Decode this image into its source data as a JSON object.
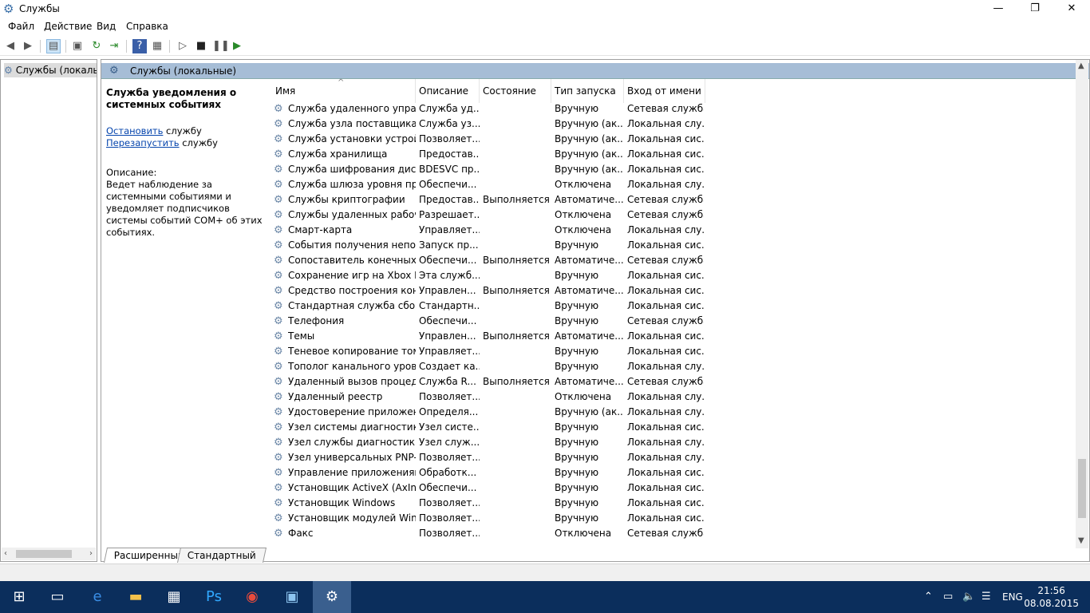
{
  "window": {
    "title": "Службы"
  },
  "menu": [
    "Файл",
    "Действие",
    "Вид",
    "Справка"
  ],
  "tree": {
    "item": "Службы (локалы"
  },
  "header": {
    "title": "Службы (локальные)"
  },
  "details": {
    "service_title": "Служба уведомления о системных событиях",
    "stop_link": "Остановить",
    "stop_suffix": " службу",
    "restart_link": "Перезапустить",
    "restart_suffix": " службу",
    "description_label": "Описание:",
    "description_text": "Ведет наблюдение за системными событиями и уведомляет подписчиков системы событий COM+ об этих событиях."
  },
  "columns": {
    "name": "Имя",
    "description": "Описание",
    "state": "Состояние",
    "startup": "Тип запуска",
    "logon": "Вход от имени"
  },
  "rows": [
    {
      "name": "Служба удаленного управ...",
      "desc": "Служба уд...",
      "state": "",
      "startup": "Вручную",
      "logon": "Сетевая служба"
    },
    {
      "name": "Служба узла поставщика ...",
      "desc": "Служба уз...",
      "state": "",
      "startup": "Вручную (ак...",
      "logon": "Локальная слу..."
    },
    {
      "name": "Служба установки устрой...",
      "desc": "Позволяет...",
      "state": "",
      "startup": "Вручную (ак...",
      "logon": "Локальная сис..."
    },
    {
      "name": "Служба хранилища",
      "desc": "Предостав...",
      "state": "",
      "startup": "Вручную (ак...",
      "logon": "Локальная сис..."
    },
    {
      "name": "Служба шифрования диск...",
      "desc": "BDESVC пр...",
      "state": "",
      "startup": "Вручную (ак...",
      "logon": "Локальная сис..."
    },
    {
      "name": "Служба шлюза уровня пр...",
      "desc": "Обеспечи...",
      "state": "",
      "startup": "Отключена",
      "logon": "Локальная слу..."
    },
    {
      "name": "Службы криптографии",
      "desc": "Предостав...",
      "state": "Выполняется",
      "startup": "Автоматиче...",
      "logon": "Сетевая служба"
    },
    {
      "name": "Службы удаленных рабоч...",
      "desc": "Разрешает...",
      "state": "",
      "startup": "Отключена",
      "logon": "Сетевая служба"
    },
    {
      "name": "Смарт-карта",
      "desc": "Управляет...",
      "state": "",
      "startup": "Отключена",
      "logon": "Локальная слу..."
    },
    {
      "name": "События получения непо...",
      "desc": "Запуск пр...",
      "state": "",
      "startup": "Вручную",
      "logon": "Локальная сис..."
    },
    {
      "name": "Сопоставитель конечных ...",
      "desc": "Обеспечи...",
      "state": "Выполняется",
      "startup": "Автоматиче...",
      "logon": "Сетевая служба"
    },
    {
      "name": "Сохранение игр на Xbox Li...",
      "desc": "Эта служб...",
      "state": "",
      "startup": "Вручную",
      "logon": "Локальная сис..."
    },
    {
      "name": "Средство построения кон...",
      "desc": "Управлен...",
      "state": "Выполняется",
      "startup": "Автоматиче...",
      "logon": "Локальная сис..."
    },
    {
      "name": "Стандартная служба сбор...",
      "desc": "Стандартн...",
      "state": "",
      "startup": "Вручную",
      "logon": "Локальная сис..."
    },
    {
      "name": "Телефония",
      "desc": "Обеспечи...",
      "state": "",
      "startup": "Вручную",
      "logon": "Сетевая служба"
    },
    {
      "name": "Темы",
      "desc": "Управлен...",
      "state": "Выполняется",
      "startup": "Автоматиче...",
      "logon": "Локальная сис..."
    },
    {
      "name": "Теневое копирование тома",
      "desc": "Управляет...",
      "state": "",
      "startup": "Вручную",
      "logon": "Локальная сис..."
    },
    {
      "name": "Тополог канального уровня",
      "desc": "Создает ка...",
      "state": "",
      "startup": "Вручную",
      "logon": "Локальная слу..."
    },
    {
      "name": "Удаленный вызов процеду...",
      "desc": "Служба R...",
      "state": "Выполняется",
      "startup": "Автоматиче...",
      "logon": "Сетевая служба"
    },
    {
      "name": "Удаленный реестр",
      "desc": "Позволяет...",
      "state": "",
      "startup": "Отключена",
      "logon": "Локальная слу..."
    },
    {
      "name": "Удостоверение приложения",
      "desc": "Определя...",
      "state": "",
      "startup": "Вручную (ак...",
      "logon": "Локальная слу..."
    },
    {
      "name": "Узел системы диагностики",
      "desc": "Узел систе...",
      "state": "",
      "startup": "Вручную",
      "logon": "Локальная сис..."
    },
    {
      "name": "Узел службы диагностики",
      "desc": "Узел служ...",
      "state": "",
      "startup": "Вручную",
      "logon": "Локальная слу..."
    },
    {
      "name": "Узел универсальных PNP-...",
      "desc": "Позволяет...",
      "state": "",
      "startup": "Вручную",
      "logon": "Локальная слу..."
    },
    {
      "name": "Управление приложениями",
      "desc": "Обработк...",
      "state": "",
      "startup": "Вручную",
      "logon": "Локальная сис..."
    },
    {
      "name": "Установщик ActiveX (AxIns...",
      "desc": "Обеспечи...",
      "state": "",
      "startup": "Вручную",
      "logon": "Локальная сис..."
    },
    {
      "name": "Установщик Windows",
      "desc": "Позволяет...",
      "state": "",
      "startup": "Вручную",
      "logon": "Локальная сис..."
    },
    {
      "name": "Установщик модулей Win...",
      "desc": "Позволяет...",
      "state": "",
      "startup": "Вручную",
      "logon": "Локальная сис..."
    },
    {
      "name": "Факс",
      "desc": "Позволяет...",
      "state": "",
      "startup": "Отключена",
      "logon": "Сетевая служба"
    }
  ],
  "tabs": [
    "Расширенный",
    "Стандартный"
  ],
  "taskbar": {
    "lang": "ENG",
    "time": "21:56",
    "date": "08.08.2015"
  }
}
